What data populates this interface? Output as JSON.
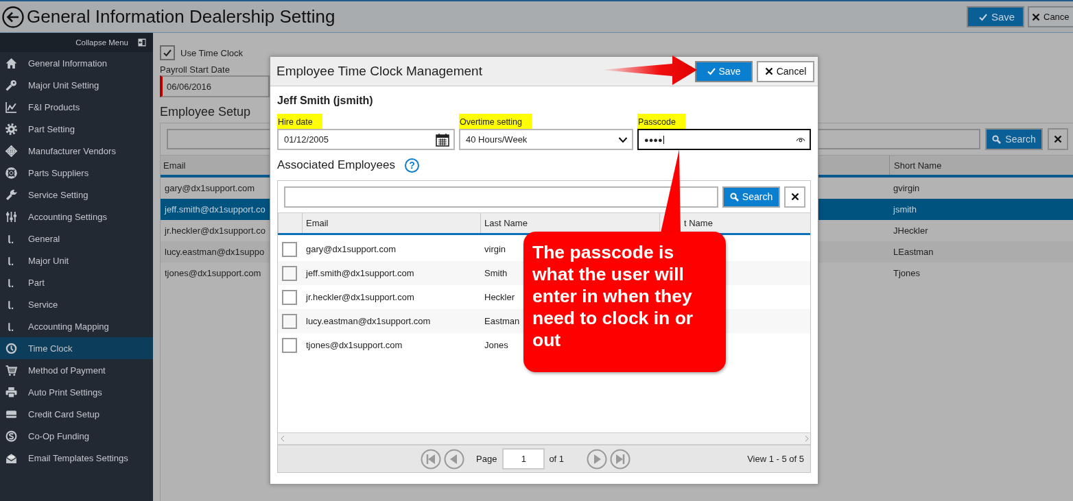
{
  "header": {
    "title": "General Information Dealership Setting",
    "buttons": [
      {
        "label": "Save",
        "kind": "primary"
      },
      {
        "label": "Cance",
        "kind": "secondary"
      }
    ]
  },
  "sidebar": {
    "collapse_label": "Collapse Menu",
    "items": [
      {
        "label": "General Information",
        "selected": false
      },
      {
        "label": "Major Unit Setting",
        "selected": false
      },
      {
        "label": "F&I Products",
        "selected": false
      },
      {
        "label": "Part Setting",
        "selected": false
      },
      {
        "label": "Manufacturer Vendors",
        "selected": false
      },
      {
        "label": "Parts Suppliers",
        "selected": false
      },
      {
        "label": "Service Setting",
        "selected": false
      },
      {
        "label": "Accounting Settings",
        "selected": false,
        "children": [
          {
            "label": "General",
            "selected": false
          },
          {
            "label": "Major Unit",
            "selected": false
          },
          {
            "label": "Part",
            "selected": false
          },
          {
            "label": "Service",
            "selected": false
          },
          {
            "label": "Accounting Mapping",
            "selected": false
          }
        ]
      },
      {
        "label": "Time Clock",
        "selected": true
      },
      {
        "label": "Method of Payment",
        "selected": false
      },
      {
        "label": "Auto Print Settings",
        "selected": false
      },
      {
        "label": "Credit Card Setup",
        "selected": false
      },
      {
        "label": "Co-Op Funding",
        "selected": false
      },
      {
        "label": "Email Templates Settings",
        "selected": false
      }
    ]
  },
  "settings": {
    "use_time_clock": {
      "label": "Use Time Clock",
      "checked": true
    },
    "payroll_start_date": {
      "label": "Payroll Start Date",
      "value": "06/06/2016"
    },
    "employee_setup": {
      "title": "Employee Setup",
      "search_button": "Search",
      "columns": [
        "Email",
        "Short Name"
      ],
      "rows": [
        {
          "email": "gary@dx1support.com",
          "short_name": "gvirgin",
          "selected": false
        },
        {
          "email": "jeff.smith@dx1support.co",
          "short_name": "jsmith",
          "selected": true
        },
        {
          "email": "jr.heckler@dx1support.co",
          "short_name": "JHeckler",
          "selected": false
        },
        {
          "email": "lucy.eastman@dx1suppo",
          "short_name": "LEastman",
          "selected": false
        },
        {
          "email": "tjones@dx1support.com",
          "short_name": "Tjones",
          "selected": false
        }
      ]
    }
  },
  "modal": {
    "title": "Employee Time Clock Management",
    "buttons": [
      {
        "label": "Save",
        "kind": "primary"
      },
      {
        "label": "Cancel",
        "kind": "secondary"
      }
    ],
    "employee_name": "Jeff Smith (jsmith)",
    "fields": [
      {
        "label": "Hire date",
        "kind": "date",
        "value": "01/12/2005",
        "focused": false
      },
      {
        "label": "Overtime setting",
        "kind": "select",
        "value": "40 Hours/Week",
        "focused": false
      },
      {
        "label": "Passcode",
        "kind": "password",
        "value": "●●●●",
        "focused": true
      }
    ],
    "associated_employees": {
      "title": "Associated Employees",
      "help": "?",
      "search_button": "Search",
      "columns": [
        "Email",
        "Last Name",
        "t Name"
      ],
      "rows": [
        {
          "email": "gary@dx1support.com",
          "last_name": "virgin",
          "checked": false
        },
        {
          "email": "jeff.smith@dx1support.com",
          "last_name": "Smith",
          "checked": false
        },
        {
          "email": "jr.heckler@dx1support.com",
          "last_name": "Heckler",
          "checked": false
        },
        {
          "email": "lucy.eastman@dx1support.com",
          "last_name": "Eastman",
          "checked": false
        },
        {
          "email": "tjones@dx1support.com",
          "last_name": "Jones",
          "checked": false
        }
      ],
      "pager": {
        "page_label": "Page",
        "page": "1",
        "of_label": "of 1",
        "summary": "View 1 - 5 of 5"
      }
    }
  },
  "callout": {
    "text": "The passcode is what the user will enter in when they need to clock in or out"
  }
}
